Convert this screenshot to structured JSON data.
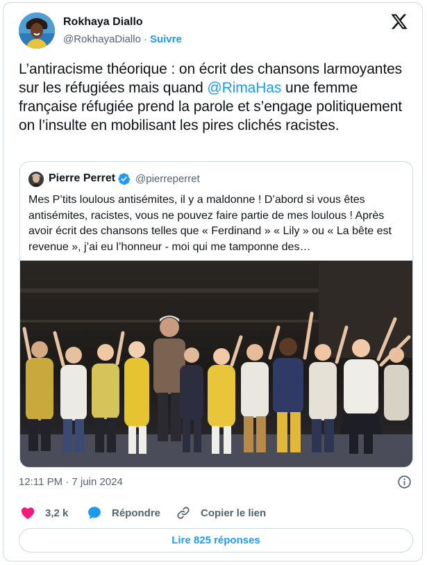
{
  "author": {
    "name": "Rokhaya Diallo",
    "handle": "@RokhayaDiallo",
    "separator": "·",
    "follow_label": "Suivre"
  },
  "tweet": {
    "text_before": "L’antiracisme théorique : on écrit des chansons larmoyantes sur les réfugiées mais quand ",
    "mention": "@RimaHas",
    "text_after": " une femme française réfugiée prend la parole et s’engage politiquement on l’insulte en mobilisant les pires clichés racistes."
  },
  "quoted": {
    "name": "Pierre Perret",
    "handle": "@pierreperret",
    "verified": true,
    "text": "Mes P’tits loulous antisémites, il y a maldonne ! D’abord si vous êtes antisémites, racistes, vous ne pouvez faire partie de mes loulous ! Après avoir écrit des chansons telles que « Ferdinand » « Lily » ou « La bête est revenue », j’ai eu l’honneur - moi qui me tamponne des…"
  },
  "meta": {
    "timestamp": "12:11 PM · 7 juin 2024"
  },
  "actions": {
    "like_count": "3,2 k",
    "reply_label": "Répondre",
    "copy_label": "Copier le lien"
  },
  "replies_button": "Lire 825 réponses",
  "colors": {
    "accent": "#1d9bf0",
    "like": "#f91880",
    "muted": "#536471",
    "border": "#cfd9de"
  },
  "icons": [
    "x-logo-icon",
    "verified-badge-icon",
    "info-icon",
    "heart-icon",
    "reply-bubble-icon",
    "link-icon"
  ]
}
